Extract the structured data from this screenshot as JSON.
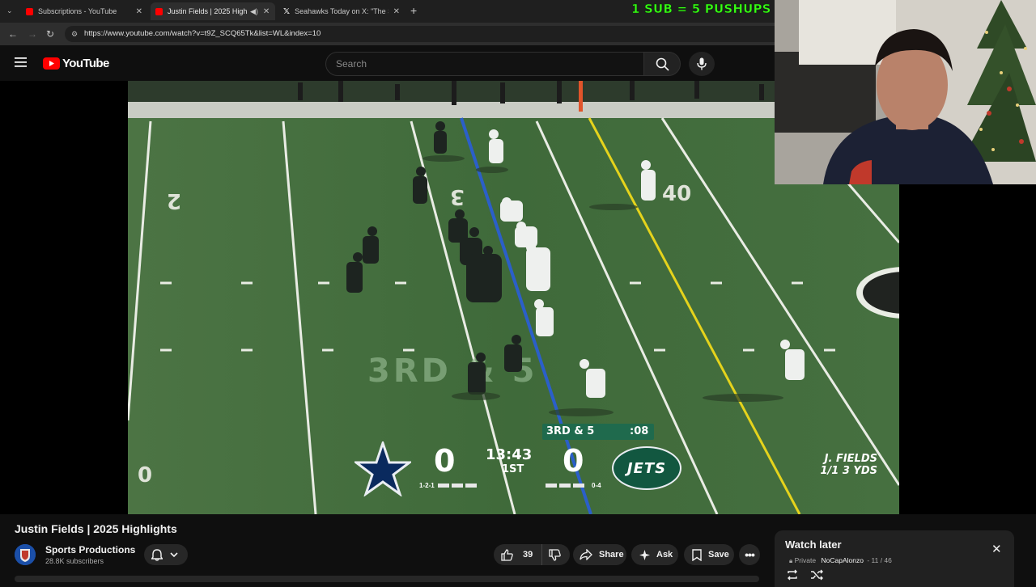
{
  "browser": {
    "tabs": [
      {
        "title": "Subscriptions - YouTube",
        "active": false
      },
      {
        "title": "Justin Fields | 2025 Highlights",
        "active": true
      },
      {
        "title": "Seahawks Today on X: \"The Sea",
        "active": false
      }
    ],
    "url": "https://www.youtube.com/watch?v=t9Z_SCQ65Tk&list=WL&index=10"
  },
  "header": {
    "logo_text": "YouTube",
    "search_placeholder": "Search"
  },
  "overlay": {
    "pushups_text": "1 SUB = 5 PUSHUPS"
  },
  "scoreboard": {
    "away_score": "0",
    "home_score": "0",
    "clock": "13:43",
    "quarter": "1ST",
    "down_distance": "3RD & 5",
    "play_clock": ":08",
    "away_record": "1-2-1",
    "home_record": "0-4",
    "home_team": "JETS",
    "field_down_text": "3RD & 5",
    "player_name": "J. FIELDS",
    "player_stat": "1/1 3 YDS"
  },
  "video": {
    "title": "Justin Fields | 2025 Highlights",
    "channel": "Sports Productions",
    "subscribers": "28.8K subscribers",
    "likes": "39",
    "share_label": "Share",
    "ask_label": "Ask",
    "save_label": "Save"
  },
  "watch_later": {
    "title": "Watch later",
    "privacy": "Private",
    "owner": "NoCapAlonzo",
    "position": "- 11 / 46"
  },
  "colors": {
    "yt_red": "#ff0000",
    "accent_green": "#39ff14",
    "field_green": "#41683a",
    "jets_green": "#125740",
    "cowboys_navy": "#0a2a5e"
  }
}
